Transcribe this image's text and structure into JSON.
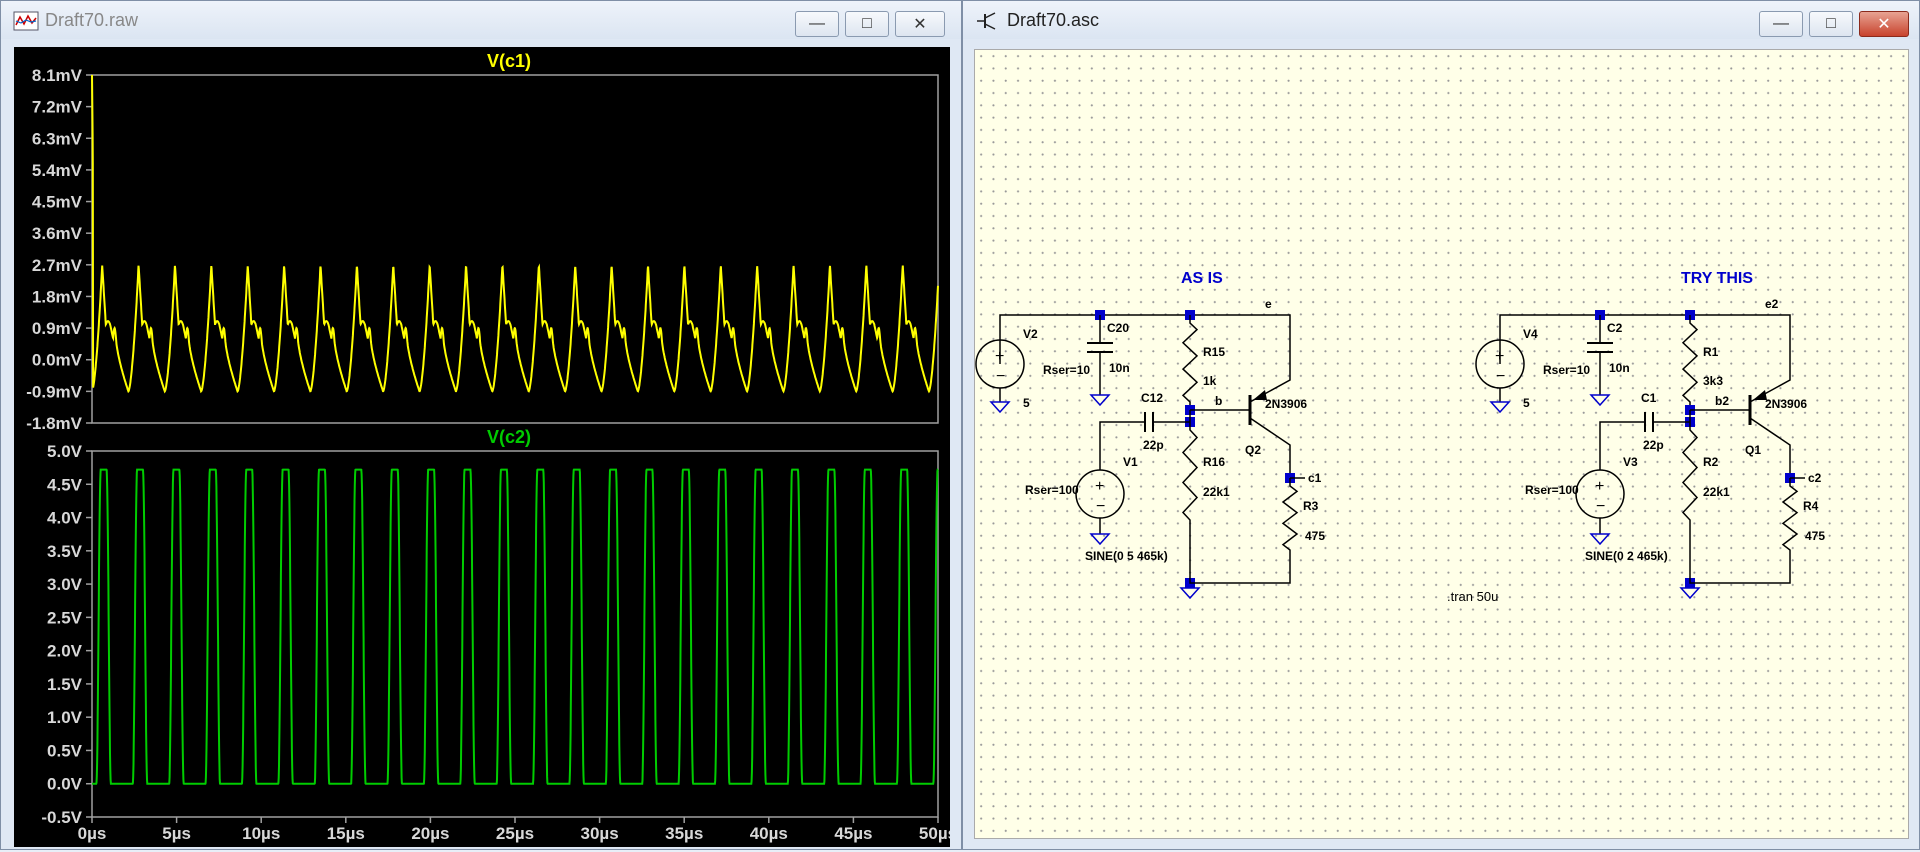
{
  "waveform_window": {
    "title": "Draft70.raw",
    "pane1": {
      "trace": "V(c1)",
      "color": "#ffff00",
      "yticks": [
        "8.1mV",
        "7.2mV",
        "6.3mV",
        "5.4mV",
        "4.5mV",
        "3.6mV",
        "2.7mV",
        "1.8mV",
        "0.9mV",
        "0.0mV",
        "-0.9mV",
        "-1.8mV"
      ]
    },
    "pane2": {
      "trace": "V(c2)",
      "color": "#00cc00",
      "yticks": [
        "5.0V",
        "4.5V",
        "4.0V",
        "3.5V",
        "3.0V",
        "2.5V",
        "2.0V",
        "1.5V",
        "1.0V",
        "0.5V",
        "0.0V",
        "-0.5V"
      ]
    },
    "xticks": [
      "0µs",
      "5µs",
      "10µs",
      "15µs",
      "20µs",
      "25µs",
      "30µs",
      "35µs",
      "40µs",
      "45µs",
      "50µs"
    ]
  },
  "schematic_window": {
    "title": "Draft70.asc",
    "circuit_left": {
      "heading": "AS IS",
      "net_e": "e",
      "net_b": "b",
      "net_c": "c1",
      "v_supply": "V2",
      "v_supply_val": "5",
      "rser_supply": "Rser=10",
      "cap_bypass": "C20",
      "cap_bypass_val": "10n",
      "r_top": "R15",
      "r_top_val": "1k",
      "cap_couple": "C12",
      "cap_couple_val": "22p",
      "v_src": "V1",
      "rser_src": "Rser=100",
      "sine": "SINE(0 5 465k)",
      "r_bias": "R16",
      "r_bias_val": "22k1",
      "transistor": "Q2",
      "transistor_model": "2N3906",
      "r_load": "R3",
      "r_load_val": "475"
    },
    "circuit_right": {
      "heading": "TRY THIS",
      "net_e": "e2",
      "net_b": "b2",
      "net_c": "c2",
      "v_supply": "V4",
      "v_supply_val": "5",
      "rser_supply": "Rser=10",
      "cap_bypass": "C2",
      "cap_bypass_val": "10n",
      "r_top": "R1",
      "r_top_val": "3k3",
      "cap_couple": "C1",
      "cap_couple_val": "22p",
      "v_src": "V3",
      "rser_src": "Rser=100",
      "sine": "SINE(0 2 465k)",
      "r_bias": "R2",
      "r_bias_val": "22k1",
      "transistor": "Q1",
      "transistor_model": "2N3906",
      "r_load": "R4",
      "r_load_val": "475"
    },
    "directive": ".tran 50u"
  }
}
